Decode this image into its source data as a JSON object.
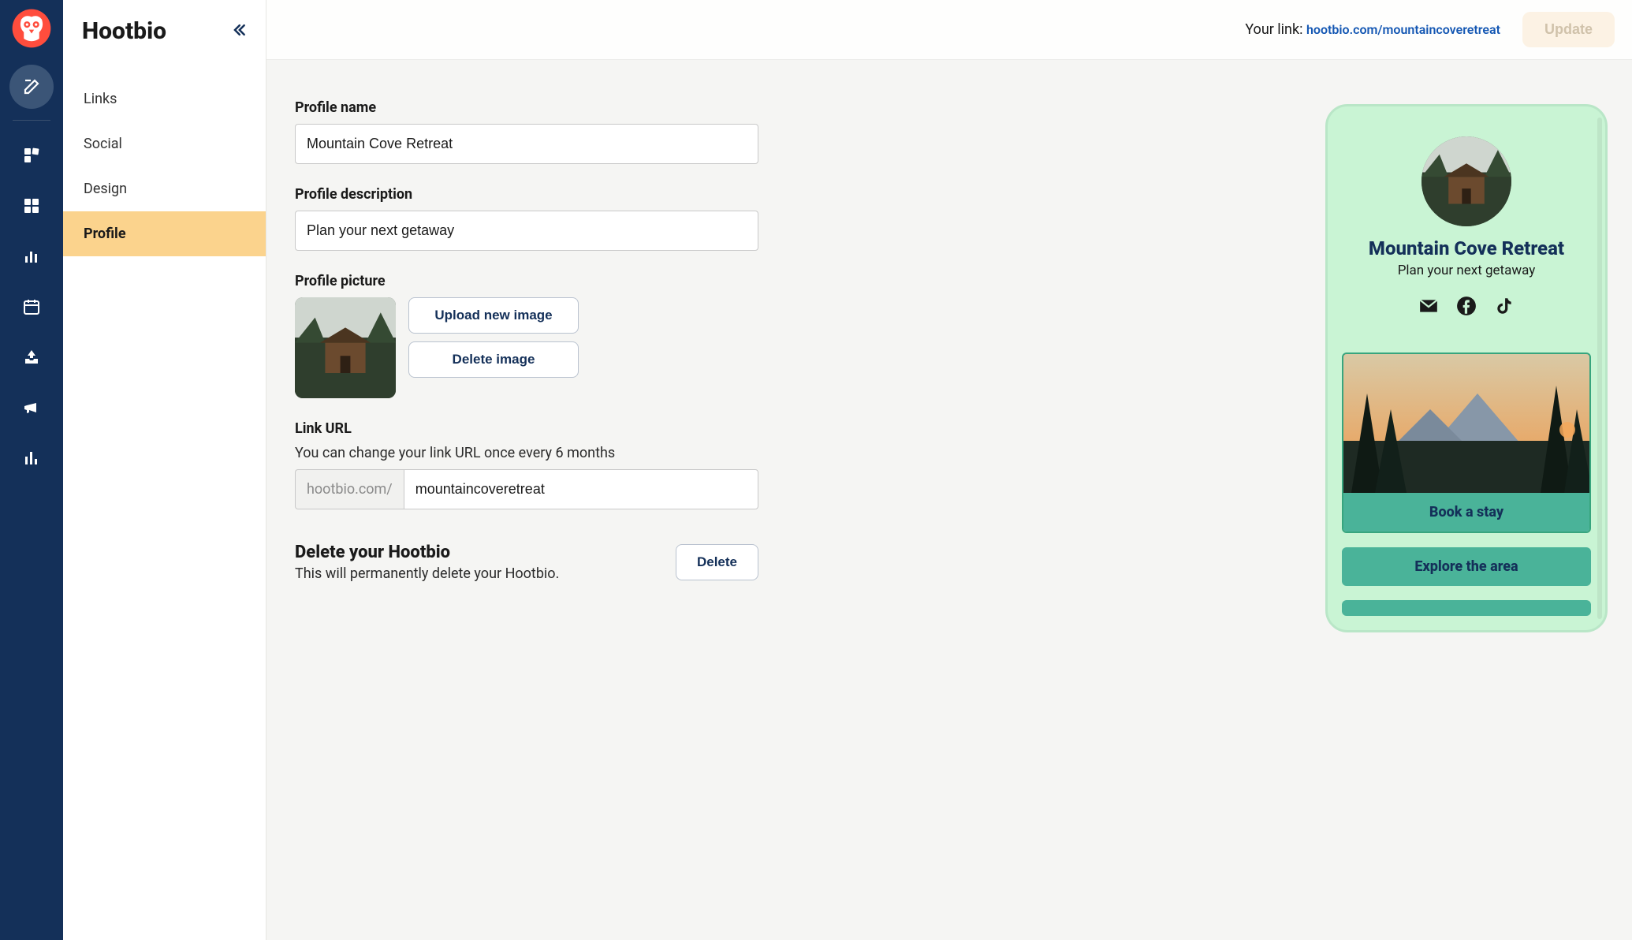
{
  "app": {
    "title": "Hootbio"
  },
  "sidebar": {
    "items": [
      {
        "label": "Links"
      },
      {
        "label": "Social"
      },
      {
        "label": "Design"
      },
      {
        "label": "Profile"
      }
    ],
    "activeIndex": 3
  },
  "topbar": {
    "linkLabel": "Your link: ",
    "linkUrl": "hootbio.com/mountaincoveretreat",
    "updateLabel": "Update"
  },
  "form": {
    "profileNameLabel": "Profile name",
    "profileNameValue": "Mountain Cove Retreat",
    "profileDescLabel": "Profile description",
    "profileDescValue": "Plan your next getaway",
    "profilePicLabel": "Profile picture",
    "uploadLabel": "Upload new image",
    "deleteImageLabel": "Delete image",
    "linkUrlLabel": "Link URL",
    "linkUrlSubtext": "You can change your link URL once every 6 months",
    "linkPrefix": "hootbio.com/",
    "linkValue": "mountaincoveretreat",
    "deleteTitle": "Delete your Hootbio",
    "deleteSub": "This will permanently delete your Hootbio.",
    "deleteBtn": "Delete"
  },
  "preview": {
    "name": "Mountain Cove Retreat",
    "desc": "Plan your next getaway",
    "cardLabel": "Book a stay",
    "linkBtn1": "Explore the area"
  }
}
